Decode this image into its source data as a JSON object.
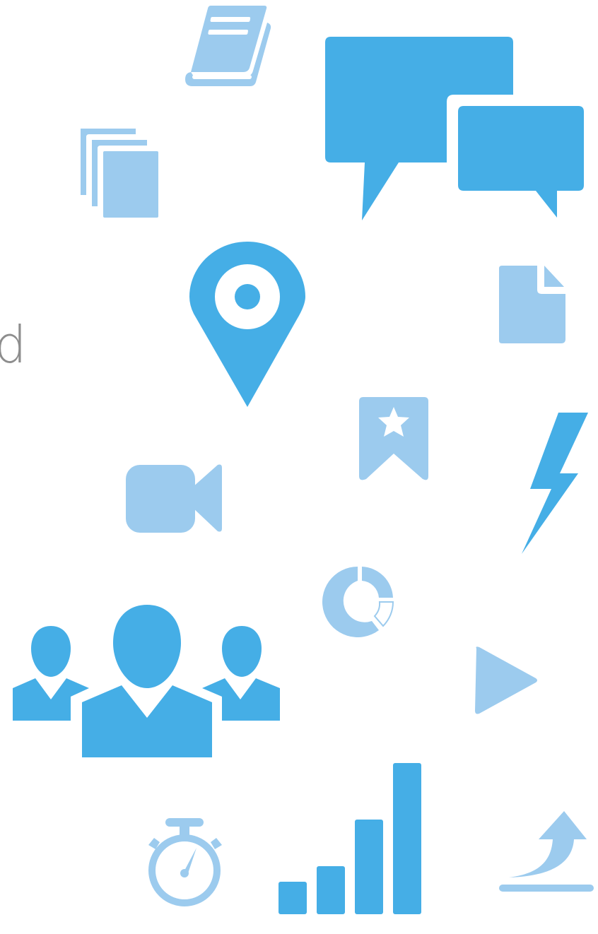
{
  "colors": {
    "primary_blue": "#45aee6",
    "light_blue": "#9ccbee",
    "text_gray": "#8d8d8d",
    "background": "#ffffff"
  },
  "partial_text": "d",
  "icons": [
    "book-icon",
    "chat-bubbles-icon",
    "document-stack-icon",
    "location-pin-icon",
    "file-icon",
    "bookmark-star-icon",
    "lightning-bolt-icon",
    "video-camera-icon",
    "donut-chart-icon",
    "team-users-icon",
    "play-icon",
    "stopwatch-icon",
    "bar-chart-icon",
    "upload-arrow-icon"
  ]
}
